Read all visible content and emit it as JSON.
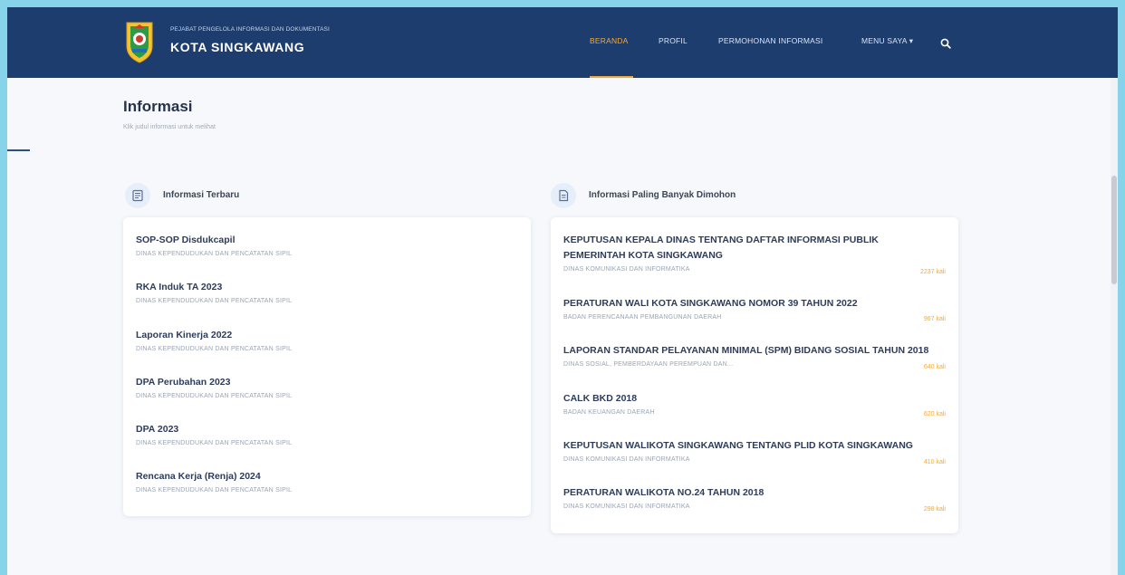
{
  "header": {
    "org_small": "PEJABAT PENGELOLA INFORMASI DAN DOKUMENTASI",
    "org_name": "KOTA SINGKAWANG",
    "nav": [
      {
        "label": "BERANDA",
        "active": true
      },
      {
        "label": "PROFIL",
        "active": false
      },
      {
        "label": "PERMOHONAN INFORMASI",
        "active": false
      },
      {
        "label": "MENU SAYA ▾",
        "active": false
      }
    ],
    "accent_color": "#f2a93b",
    "bar_color": "#1d3d6e"
  },
  "page": {
    "title": "Informasi",
    "subtitle": "Klik judul informasi untuk melihat"
  },
  "latest": {
    "heading": "Informasi Terbaru",
    "items": [
      {
        "title": "SOP-SOP Disdukcapil",
        "source": "DINAS KEPENDUDUKAN DAN PENCATATAN SIPIL"
      },
      {
        "title": "RKA Induk TA 2023",
        "source": "DINAS KEPENDUDUKAN DAN PENCATATAN SIPIL"
      },
      {
        "title": "Laporan Kinerja 2022",
        "source": "DINAS KEPENDUDUKAN DAN PENCATATAN SIPIL"
      },
      {
        "title": "DPA Perubahan 2023",
        "source": "DINAS KEPENDUDUKAN DAN PENCATATAN SIPIL"
      },
      {
        "title": "DPA 2023",
        "source": "DINAS KEPENDUDUKAN DAN PENCATATAN SIPIL"
      },
      {
        "title": "Rencana Kerja (Renja) 2024",
        "source": "DINAS KEPENDUDUKAN DAN PENCATATAN SIPIL"
      }
    ]
  },
  "popular": {
    "heading": "Informasi Paling Banyak Dimohon",
    "items": [
      {
        "title": "KEPUTUSAN KEPALA DINAS TENTANG DAFTAR INFORMASI PUBLIK",
        "title2": "PEMERINTAH KOTA SINGKAWANG",
        "source": "DINAS KOMUNIKASI DAN INFORMATIKA",
        "count": "2237 kali"
      },
      {
        "title": "PERATURAN WALI KOTA SINGKAWANG NOMOR 39 TAHUN 2022",
        "source": "BADAN PERENCANAAN PEMBANGUNAN DAERAH",
        "count": "967 kali"
      },
      {
        "title": "LAPORAN STANDAR PELAYANAN MINIMAL (SPM) BIDANG SOSIAL TAHUN 2018",
        "source": "DINAS SOSIAL, PEMBERDAYAAN PEREMPUAN DAN...",
        "count": "640 kali"
      },
      {
        "title": "CALK BKD 2018",
        "source": "BADAN KEUANGAN DAERAH",
        "count": "620 kali"
      },
      {
        "title": "KEPUTUSAN WALIKOTA SINGKAWANG TENTANG PLID KOTA SINGKAWANG",
        "source": "DINAS KOMUNIKASI DAN INFORMATIKA",
        "count": "410 kali"
      },
      {
        "title": "PERATURAN WALIKOTA NO.24 TAHUN 2018",
        "source": "DINAS KOMUNIKASI DAN INFORMATIKA",
        "count": "298 kali"
      }
    ]
  },
  "icons": {
    "logo": "city-emblem",
    "search": "search-icon",
    "latest": "document-stack-icon",
    "popular": "document-icon"
  }
}
